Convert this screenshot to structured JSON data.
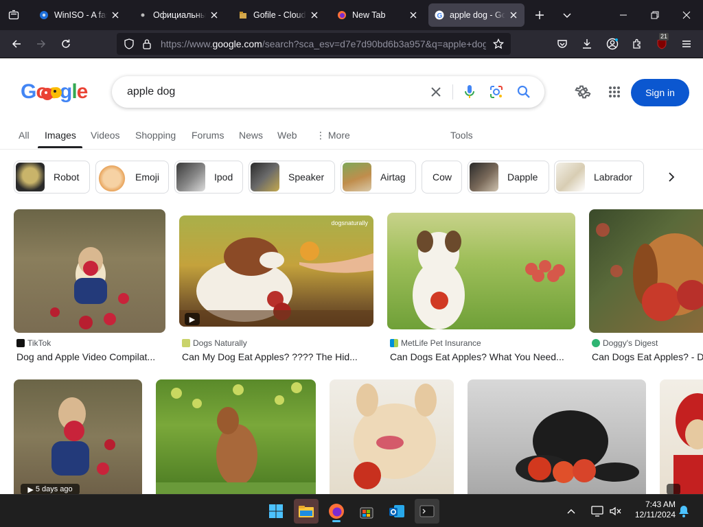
{
  "browser": {
    "tabs": [
      {
        "title": "WinISO - A fast"
      },
      {
        "title": "Официальный"
      },
      {
        "title": "Gofile - Cloud S"
      },
      {
        "title": "New Tab"
      },
      {
        "title": "apple dog - Goo"
      }
    ],
    "url": {
      "prefix": "https://www.",
      "host": "google.com",
      "path": "/search?sca_esv=d7e7d90bd6b3a957&q=apple+dog"
    },
    "extension_badge": "21"
  },
  "google": {
    "query": "apple dog",
    "sign_in_label": "Sign in",
    "search_tabs": [
      "All",
      "Images",
      "Videos",
      "Shopping",
      "Forums",
      "News",
      "Web",
      "More"
    ],
    "tools_label": "Tools",
    "chips": [
      "Robot",
      "Emoji",
      "Ipod",
      "Speaker",
      "Airtag",
      "Cow",
      "Dapple",
      "Labrador"
    ],
    "results_row1": [
      {
        "source": "TikTok",
        "title": "Dog and Apple Video Compilat..."
      },
      {
        "source": "Dogs Naturally",
        "title": "Can My Dog Eat Apples? ???? The Hid..."
      },
      {
        "source": "MetLife Pet Insurance",
        "title": "Can Dogs Eat Apples? What You Need..."
      },
      {
        "source": "Doggy's Digest",
        "title": "Can Dogs Eat Apples? - D..."
      }
    ],
    "results_row2_badge": "5 days ago",
    "watermark": "dogsnaturally"
  },
  "taskbar": {
    "time": "7:43 AM",
    "date": "12/11/2024"
  }
}
